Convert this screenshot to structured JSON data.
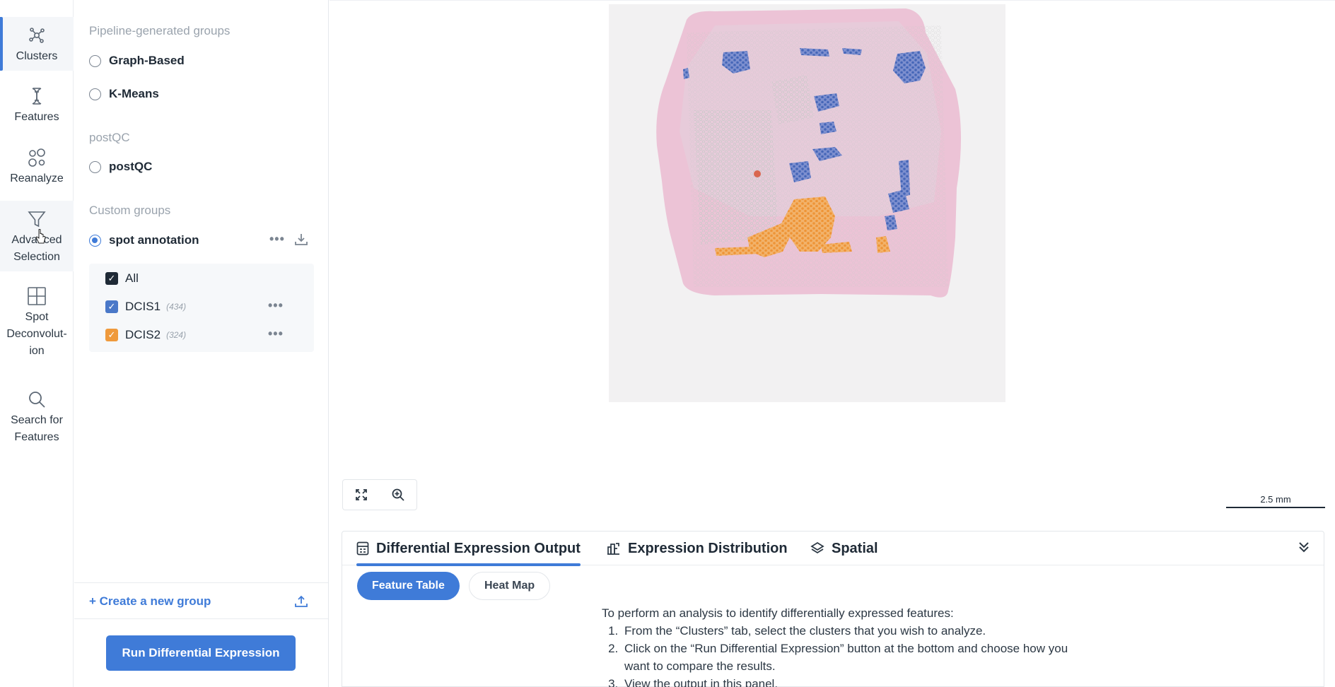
{
  "rail": {
    "items": [
      {
        "label": "Clusters",
        "icon": "clusters-icon"
      },
      {
        "label": "Features",
        "icon": "features-icon"
      },
      {
        "label": "Reanalyze",
        "icon": "reanalyze-icon"
      },
      {
        "label": "Advanced Selection",
        "icon": "filter-icon"
      },
      {
        "label": "Spot Deconvolut-ion",
        "icon": "grid-icon"
      },
      {
        "label": "Search for Features",
        "icon": "search-icon"
      }
    ]
  },
  "panel": {
    "pipeline_title": "Pipeline-generated groups",
    "graph_based": "Graph-Based",
    "kmeans": "K-Means",
    "postqc_title": "postQC",
    "postqc": "postQC",
    "custom_title": "Custom groups",
    "spot_annotation": "spot annotation",
    "all": "All",
    "dcis1": "DCIS1",
    "dcis1_count": "(434)",
    "dcis2": "DCIS2",
    "dcis2_count": "(324)",
    "create_group": "+ Create a new group",
    "run_de": "Run Differential Expression",
    "colors": {
      "dcis1": "#4a78c8",
      "dcis2": "#ef9a3c",
      "accent": "#3f7bd8"
    }
  },
  "viewer": {
    "scalebar": "2.5 mm"
  },
  "bottom": {
    "tabs": [
      "Differential Expression Output",
      "Expression Distribution",
      "Spatial"
    ],
    "feature_table": "Feature Table",
    "heat_map": "Heat Map",
    "intro": "To perform an analysis to identify differentially expressed features:",
    "steps": [
      "From the “Clusters” tab, select the clusters that you wish to analyze.",
      "Click on the “Run Differential Expression” button at the bottom and choose how you want to compare the results.",
      "View the output in this panel."
    ]
  }
}
